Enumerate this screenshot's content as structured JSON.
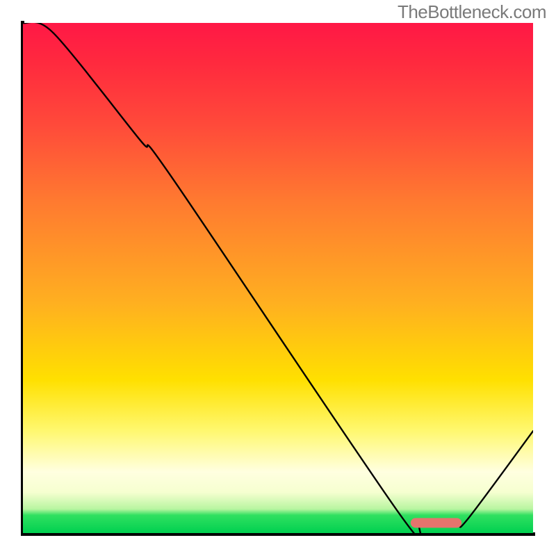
{
  "attribution": "TheBottleneck.com",
  "chart_data": {
    "type": "line",
    "title": "",
    "xlabel": "",
    "ylabel": "",
    "xlim": [
      0,
      100
    ],
    "ylim": [
      0,
      100
    ],
    "grid": false,
    "legend": false,
    "series": [
      {
        "name": "bottleneck-curve",
        "x": [
          0,
          6,
          23,
          29,
          74,
          78,
          85,
          87,
          100
        ],
        "values": [
          100,
          98,
          77,
          70,
          3.5,
          2,
          2,
          2.5,
          20
        ],
        "color": "#000000"
      }
    ],
    "annotations": [
      {
        "name": "optimal-range-marker",
        "shape": "rounded-bar",
        "x_start": 76,
        "x_end": 86,
        "y": 2,
        "color": "#e5746d"
      }
    ],
    "background": {
      "type": "vertical-gradient",
      "stops": [
        {
          "pos": 0.0,
          "color": "#ff1846"
        },
        {
          "pos": 0.35,
          "color": "#ff7a30"
        },
        {
          "pos": 0.7,
          "color": "#ffe000"
        },
        {
          "pos": 0.9,
          "color": "#ffffe0"
        },
        {
          "pos": 0.965,
          "color": "#30e060"
        },
        {
          "pos": 1.0,
          "color": "#00d050"
        }
      ]
    }
  }
}
